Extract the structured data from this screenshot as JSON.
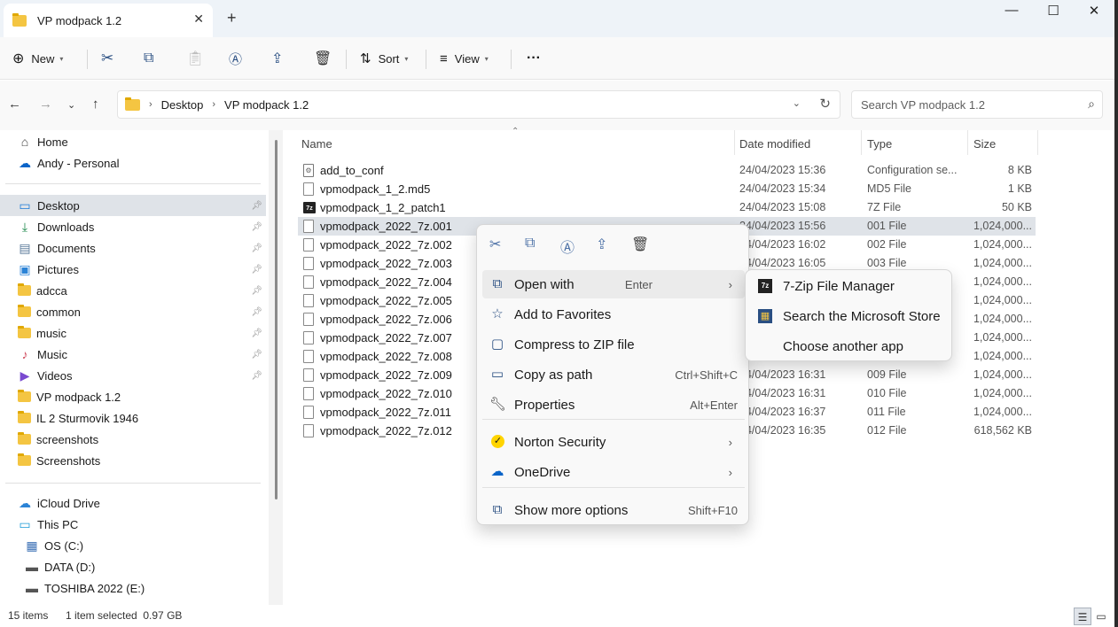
{
  "window": {
    "tab_title": "VP modpack 1.2",
    "tab_close": "✕",
    "new_tab": "+",
    "minimize": "—",
    "maximize": "☐",
    "close": "✕"
  },
  "toolbar": {
    "new_label": "New",
    "sort_label": "Sort",
    "view_label": "View",
    "more_label": "···"
  },
  "address": {
    "crumbs": [
      "Desktop",
      "VP modpack 1.2"
    ],
    "search_placeholder": "Search VP modpack 1.2"
  },
  "sidebar": {
    "top": [
      {
        "label": "Home",
        "icon": "home-icon"
      },
      {
        "label": "Andy - Personal",
        "icon": "onedrive-cloud-icon"
      }
    ],
    "quick": [
      {
        "label": "Desktop",
        "icon": "desktop-icon",
        "pinned": true,
        "selected": true
      },
      {
        "label": "Downloads",
        "icon": "download-icon",
        "pinned": true
      },
      {
        "label": "Documents",
        "icon": "document-icon",
        "pinned": true
      },
      {
        "label": "Pictures",
        "icon": "pictures-icon",
        "pinned": true
      },
      {
        "label": "adcca",
        "icon": "folder-icon",
        "pinned": true
      },
      {
        "label": "common",
        "icon": "folder-icon",
        "pinned": true
      },
      {
        "label": "music",
        "icon": "folder-icon",
        "pinned": true
      },
      {
        "label": "Music",
        "icon": "music-icon",
        "pinned": true
      },
      {
        "label": "Videos",
        "icon": "videos-icon",
        "pinned": true
      },
      {
        "label": "VP modpack 1.2",
        "icon": "folder-icon"
      },
      {
        "label": "IL 2 Sturmovik 1946",
        "icon": "folder-icon"
      },
      {
        "label": "screenshots",
        "icon": "folder-icon"
      },
      {
        "label": "Screenshots",
        "icon": "folder-icon"
      }
    ],
    "devices": [
      {
        "label": "iCloud Drive",
        "icon": "icloud-icon"
      },
      {
        "label": "This PC",
        "icon": "this-pc-icon"
      },
      {
        "label": "OS (C:)",
        "icon": "windows-drive-icon"
      },
      {
        "label": "DATA (D:)",
        "icon": "drive-icon"
      },
      {
        "label": "TOSHIBA 2022 (E:)",
        "icon": "drive-icon"
      }
    ]
  },
  "columns": {
    "name": "Name",
    "date": "Date modified",
    "type": "Type",
    "size": "Size"
  },
  "files": [
    {
      "name": "add_to_conf",
      "date": "24/04/2023 15:36",
      "type": "Configuration se...",
      "size": "8 KB",
      "icon": "config-file-icon"
    },
    {
      "name": "vpmodpack_1_2.md5",
      "date": "24/04/2023 15:34",
      "type": "MD5 File",
      "size": "1 KB",
      "icon": "file-icon"
    },
    {
      "name": "vpmodpack_1_2_patch1",
      "date": "24/04/2023 15:08",
      "type": "7Z File",
      "size": "50 KB",
      "icon": "7zip-file-icon"
    },
    {
      "name": "vpmodpack_2022_7z.001",
      "date": "24/04/2023 15:56",
      "type": "001 File",
      "size": "1,024,000...",
      "icon": "file-icon",
      "selected": true
    },
    {
      "name": "vpmodpack_2022_7z.002",
      "date": "24/04/2023 16:02",
      "type": "002 File",
      "size": "1,024,000...",
      "icon": "file-icon"
    },
    {
      "name": "vpmodpack_2022_7z.003",
      "date": "24/04/2023 16:05",
      "type": "003 File",
      "size": "1,024,000...",
      "icon": "file-icon"
    },
    {
      "name": "vpmodpack_2022_7z.004",
      "date": "",
      "type": "",
      "size": "1,024,000...",
      "icon": "file-icon"
    },
    {
      "name": "vpmodpack_2022_7z.005",
      "date": "",
      "type": "",
      "size": "1,024,000...",
      "icon": "file-icon"
    },
    {
      "name": "vpmodpack_2022_7z.006",
      "date": "",
      "type": "",
      "size": "1,024,000...",
      "icon": "file-icon"
    },
    {
      "name": "vpmodpack_2022_7z.007",
      "date": "",
      "type": "",
      "size": "1,024,000...",
      "icon": "file-icon"
    },
    {
      "name": "vpmodpack_2022_7z.008",
      "date": "",
      "type": "",
      "size": "1,024,000...",
      "icon": "file-icon"
    },
    {
      "name": "vpmodpack_2022_7z.009",
      "date": "24/04/2023 16:31",
      "type": "009 File",
      "size": "1,024,000...",
      "icon": "file-icon"
    },
    {
      "name": "vpmodpack_2022_7z.010",
      "date": "24/04/2023 16:31",
      "type": "010 File",
      "size": "1,024,000...",
      "icon": "file-icon"
    },
    {
      "name": "vpmodpack_2022_7z.011",
      "date": "24/04/2023 16:37",
      "type": "011 File",
      "size": "1,024,000...",
      "icon": "file-icon"
    },
    {
      "name": "vpmodpack_2022_7z.012",
      "date": "24/04/2023 16:35",
      "type": "012 File",
      "size": "618,562 KB",
      "icon": "file-icon"
    }
  ],
  "context_menu": {
    "top_icons": [
      "cut-icon",
      "copy-icon",
      "rename-icon",
      "share-icon",
      "delete-icon"
    ],
    "items": [
      {
        "label": "Open with",
        "shortcut": "Enter",
        "submenu": true,
        "icon": "open-with-icon",
        "highlighted": true
      },
      {
        "label": "Add to Favorites",
        "shortcut": "",
        "icon": "star-icon"
      },
      {
        "label": "Compress to ZIP file",
        "shortcut": "",
        "icon": "zip-icon"
      },
      {
        "label": "Copy as path",
        "shortcut": "Ctrl+Shift+C",
        "icon": "copy-path-icon"
      },
      {
        "label": "Properties",
        "shortcut": "Alt+Enter",
        "icon": "wrench-icon"
      },
      {
        "label": "Norton Security",
        "shortcut": "",
        "submenu": true,
        "icon": "norton-icon"
      },
      {
        "label": "OneDrive",
        "shortcut": "",
        "submenu": true,
        "icon": "onedrive-icon"
      },
      {
        "label": "Show more options",
        "shortcut": "Shift+F10",
        "icon": "more-options-icon"
      }
    ]
  },
  "open_with_submenu": [
    {
      "label": "7-Zip File Manager",
      "icon": "7zip-icon"
    },
    {
      "label": "Search the Microsoft Store",
      "icon": "store-icon"
    },
    {
      "label": "Choose another app",
      "icon": ""
    }
  ],
  "status": {
    "item_count": "15 items",
    "selection": "1 item selected  0.97 GB"
  },
  "colors": {
    "accent": "#0067c0",
    "selection": "#dfe3e8",
    "folder": "#f4c542"
  }
}
